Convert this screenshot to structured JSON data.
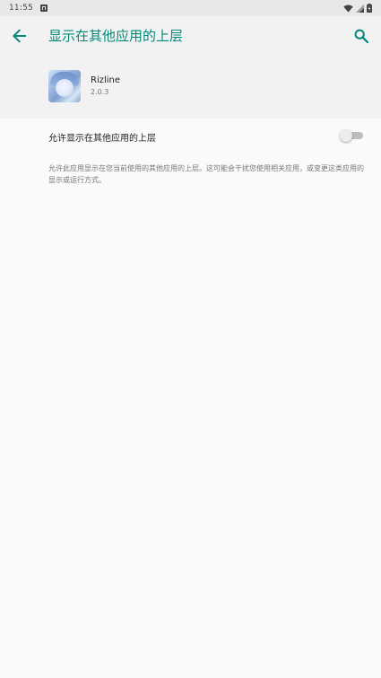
{
  "status_bar": {
    "time": "11:55",
    "icons": [
      "notification-a-icon",
      "wifi-icon",
      "signal-icon",
      "battery-icon"
    ]
  },
  "app_bar": {
    "title": "显示在其他应用的上层",
    "back_icon": "arrow-left-icon",
    "search_icon": "search-icon"
  },
  "app_info": {
    "name": "Rizline",
    "version": "2.0.3"
  },
  "setting": {
    "label": "允许显示在其他应用的上层",
    "enabled": false
  },
  "description": "允许此应用显示在您当前使用的其他应用的上层。这可能会干扰您使用相关应用，或变更这类应用的显示或运行方式。",
  "colors": {
    "accent": "#00897b",
    "background": "#fafafa",
    "header_background": "#f2f2f2",
    "status_bar_background": "#e8e8e8"
  }
}
